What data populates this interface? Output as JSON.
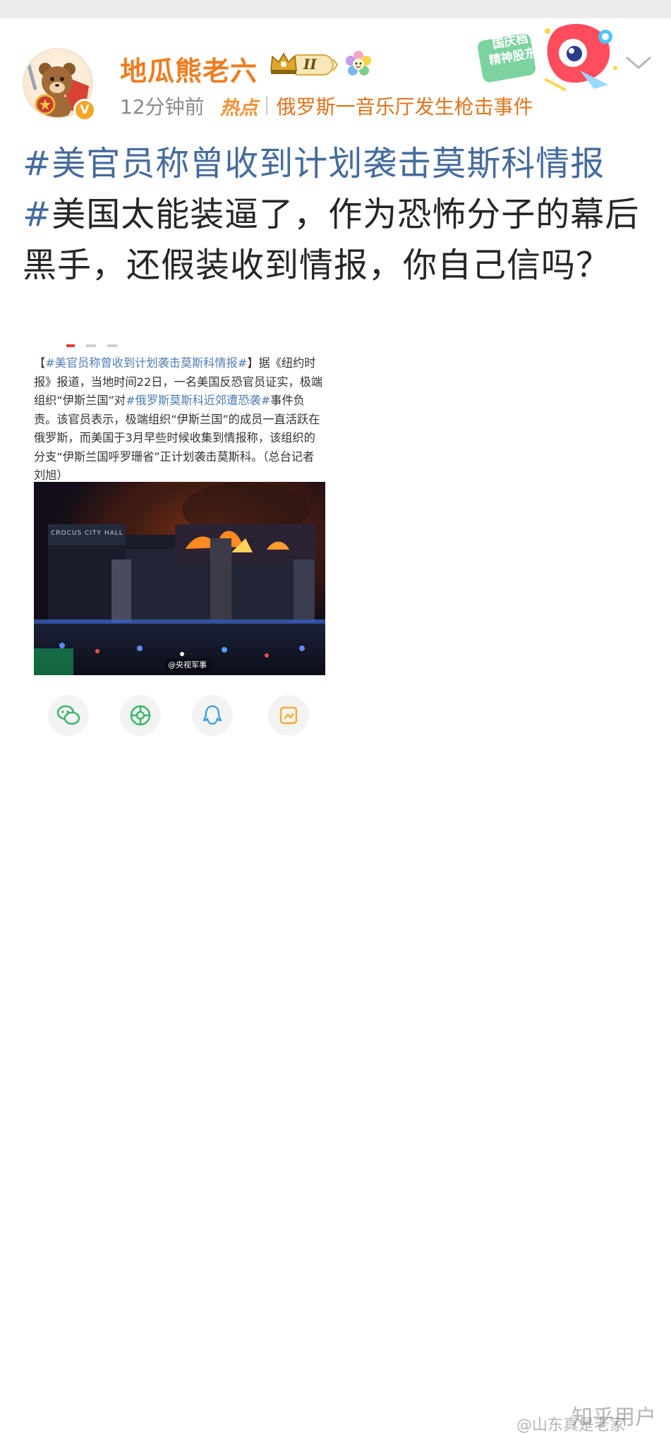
{
  "user": {
    "name": "地瓜熊老六",
    "level_badge": "II",
    "time": "12分钟前",
    "hot_label": "热点",
    "topic": "俄罗斯一音乐厅发生枪击事件"
  },
  "promo": {
    "line1": "国庆档",
    "line2": "精神股东"
  },
  "post": {
    "hashtag": "#美官员称曾收到计划袭击莫斯科情报",
    "hashtag2": "#",
    "body": "美国太能装逼了，作为恐怖分子的幕后黑手，还假装收到情报，你自己信吗？"
  },
  "news": {
    "open_bracket": "【",
    "tag1": "#美官员称曾收到计划袭击莫斯科情报#",
    "part1": "】据《纽约时报》报道，当地时间22日，一名美国反恐官员证实，极端组织“伊斯兰国”对",
    "tag2": "#俄罗斯莫斯科近郊遭恐袭#",
    "part2": "事件负责。该官员表示，极端组织“伊斯兰国”的成员一直活跃在俄罗斯，而美国于3月早些时候收集到情报称，该组织的分支“伊斯兰国呼罗珊省”正计划袭击莫斯科。（总台记者刘旭）",
    "photo_source": "@央视军事",
    "building_sign": "CROCUS CITY HALL"
  },
  "share": {
    "icons": [
      "wechat-icon",
      "moments-icon",
      "qq-icon",
      "qzone-icon"
    ]
  },
  "watermark": {
    "platform": "知乎用户",
    "handle": "@山东真是老家"
  },
  "colors": {
    "username": "#f07c1e",
    "hashtag": "#456b9c",
    "hot": "#f29138",
    "topic": "#e3731b"
  }
}
